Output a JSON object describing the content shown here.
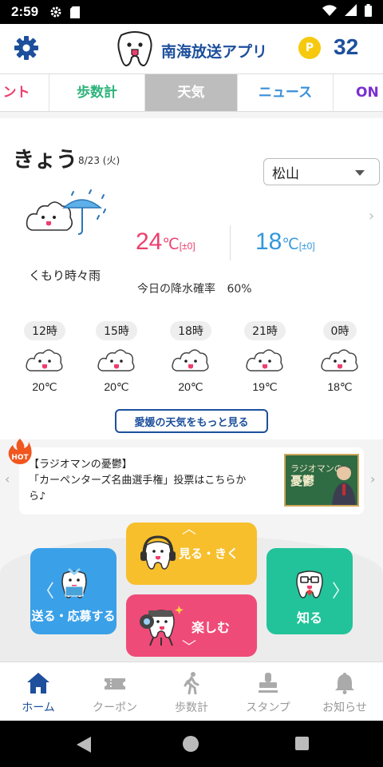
{
  "status_bar": {
    "time": "2:59"
  },
  "header": {
    "app_title": "南海放送アプリ",
    "points_badge": "P",
    "points": "32"
  },
  "tabs": [
    {
      "label": "ント",
      "color": "#ec3e6c"
    },
    {
      "label": "歩数計",
      "color": "#2db37a"
    },
    {
      "label": "天気",
      "color": "#ffffff",
      "active": true
    },
    {
      "label": "ニュース",
      "color": "#3a8fd9"
    },
    {
      "label": "ON A",
      "color": "#7a2fd0"
    }
  ],
  "weather": {
    "today_label": "きょう",
    "date": "8/23 (火)",
    "city": "松山",
    "description": "くもり時々雨",
    "high": "24",
    "high_unit": "℃",
    "high_diff": "[±0]",
    "low": "18",
    "low_unit": "℃",
    "low_diff": "[±0]",
    "rain_label": "今日の降水確率",
    "rain_value": "60%",
    "hourly": [
      {
        "time": "12時",
        "temp": "20℃"
      },
      {
        "time": "15時",
        "temp": "20℃"
      },
      {
        "time": "18時",
        "temp": "20℃"
      },
      {
        "time": "21時",
        "temp": "19℃"
      },
      {
        "time": "0時",
        "temp": "18℃"
      }
    ],
    "more_button": "愛媛の天気をもっと見る"
  },
  "banner": {
    "hot": "HOT",
    "line1": "【ラジオマンの憂鬱】",
    "line2": "「カーペンターズ名曲選手権」投票はこちらか",
    "line3": "ら♪",
    "image_title_1": "ラジオマンの",
    "image_title_2": "憂鬱"
  },
  "menu": {
    "send": "送る・応募する",
    "watch": "見る・きく",
    "enjoy": "楽しむ",
    "know": "知る"
  },
  "bottom_nav": [
    {
      "label": "ホーム",
      "icon": "home-icon",
      "active": true
    },
    {
      "label": "クーポン",
      "icon": "coupon-icon"
    },
    {
      "label": "歩数計",
      "icon": "walk-icon"
    },
    {
      "label": "スタンプ",
      "icon": "stamp-icon"
    },
    {
      "label": "お知らせ",
      "icon": "bell-icon"
    }
  ],
  "colors": {
    "brand_blue": "#1d4f9c",
    "high_temp": "#ec3e6c",
    "low_temp": "#3498db"
  }
}
